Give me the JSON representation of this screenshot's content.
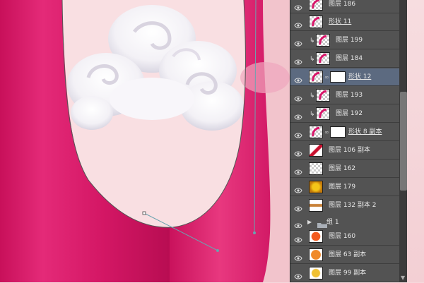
{
  "canvas": {
    "description_colors": {
      "magenta": "#d8166a",
      "pink_bg": "#f7dadd",
      "cloud": "#ffffff"
    }
  },
  "layers": [
    {
      "name": "图层 186",
      "type": "pattern",
      "clip": false,
      "underline": false
    },
    {
      "name": "形状 11",
      "type": "shape",
      "clip": false,
      "underline": true
    },
    {
      "name": "图层 199",
      "type": "pattern",
      "clip": true,
      "underline": false
    },
    {
      "name": "图层 184",
      "type": "pattern",
      "clip": true,
      "underline": false
    },
    {
      "name": "形状 12",
      "type": "shape-mask",
      "clip": false,
      "underline": true,
      "selected": true
    },
    {
      "name": "图层 193",
      "type": "pattern",
      "clip": true,
      "underline": false
    },
    {
      "name": "图层 192",
      "type": "pattern",
      "clip": true,
      "underline": false
    },
    {
      "name": "形状 8 副本",
      "type": "shape-mask",
      "clip": false,
      "underline": true
    },
    {
      "name": "图层 106 副本",
      "type": "red-stroke",
      "clip": false,
      "underline": false
    },
    {
      "name": "图层 162",
      "type": "empty",
      "clip": false,
      "underline": false
    },
    {
      "name": "图层 179",
      "type": "gold",
      "clip": false,
      "underline": false
    },
    {
      "name": "图层 132 副本 2",
      "type": "brown",
      "clip": false,
      "underline": false
    },
    {
      "name": "组 1",
      "type": "group",
      "clip": false,
      "underline": false
    },
    {
      "name": "图层 160",
      "type": "orange-red",
      "clip": false,
      "underline": false
    },
    {
      "name": "图层 63 副本",
      "type": "orange",
      "clip": false,
      "underline": false
    },
    {
      "name": "图层 99 副本",
      "type": "yellow",
      "clip": false,
      "underline": false
    }
  ],
  "colors": {
    "panel_bg": "#535353",
    "selected_bg": "#5c6a80",
    "text": "#e8e8e8"
  }
}
